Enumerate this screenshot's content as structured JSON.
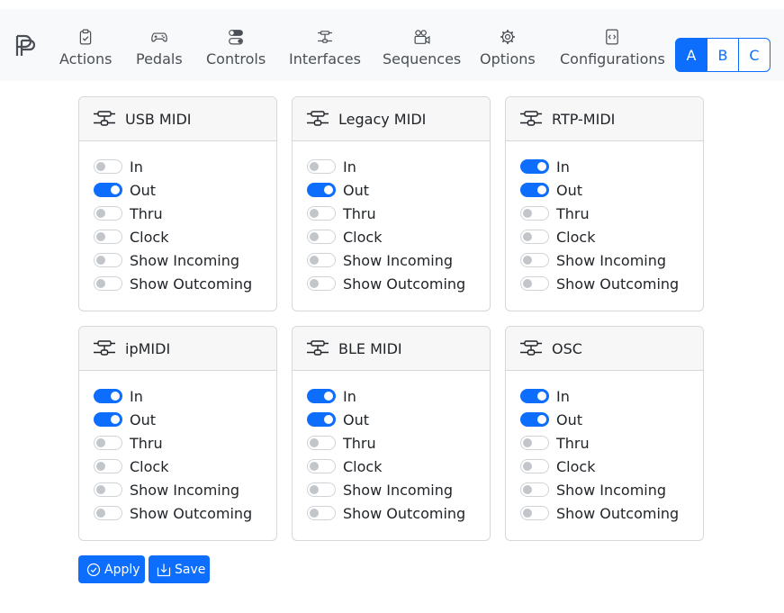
{
  "nav": {
    "items": [
      {
        "label": "Actions",
        "icon": "clipboard-check-icon"
      },
      {
        "label": "Pedals",
        "icon": "controller-icon"
      },
      {
        "label": "Controls",
        "icon": "toggles-icon"
      },
      {
        "label": "Interfaces",
        "icon": "sliders-icon"
      },
      {
        "label": "Sequences",
        "icon": "camera-reels-icon"
      },
      {
        "label": "Options",
        "icon": "gear-icon"
      },
      {
        "label": "Configurations",
        "icon": "file-code-icon"
      }
    ],
    "profiles": [
      {
        "label": "A",
        "active": true
      },
      {
        "label": "B",
        "active": false
      },
      {
        "label": "C",
        "active": false
      }
    ]
  },
  "interfaces": [
    {
      "title": "USB MIDI",
      "options": [
        {
          "label": "In",
          "on": false
        },
        {
          "label": "Out",
          "on": true
        },
        {
          "label": "Thru",
          "on": false
        },
        {
          "label": "Clock",
          "on": false
        },
        {
          "label": "Show Incoming",
          "on": false
        },
        {
          "label": "Show Outcoming",
          "on": false
        }
      ]
    },
    {
      "title": "Legacy MIDI",
      "options": [
        {
          "label": "In",
          "on": false
        },
        {
          "label": "Out",
          "on": true
        },
        {
          "label": "Thru",
          "on": false
        },
        {
          "label": "Clock",
          "on": false
        },
        {
          "label": "Show Incoming",
          "on": false
        },
        {
          "label": "Show Outcoming",
          "on": false
        }
      ]
    },
    {
      "title": "RTP-MIDI",
      "options": [
        {
          "label": "In",
          "on": true
        },
        {
          "label": "Out",
          "on": true
        },
        {
          "label": "Thru",
          "on": false
        },
        {
          "label": "Clock",
          "on": false
        },
        {
          "label": "Show Incoming",
          "on": false
        },
        {
          "label": "Show Outcoming",
          "on": false
        }
      ]
    },
    {
      "title": "ipMIDI",
      "options": [
        {
          "label": "In",
          "on": true
        },
        {
          "label": "Out",
          "on": true
        },
        {
          "label": "Thru",
          "on": false
        },
        {
          "label": "Clock",
          "on": false
        },
        {
          "label": "Show Incoming",
          "on": false
        },
        {
          "label": "Show Outcoming",
          "on": false
        }
      ]
    },
    {
      "title": "BLE MIDI",
      "options": [
        {
          "label": "In",
          "on": true
        },
        {
          "label": "Out",
          "on": true
        },
        {
          "label": "Thru",
          "on": false
        },
        {
          "label": "Clock",
          "on": false
        },
        {
          "label": "Show Incoming",
          "on": false
        },
        {
          "label": "Show Outcoming",
          "on": false
        }
      ]
    },
    {
      "title": "OSC",
      "options": [
        {
          "label": "In",
          "on": true
        },
        {
          "label": "Out",
          "on": true
        },
        {
          "label": "Thru",
          "on": false
        },
        {
          "label": "Clock",
          "on": false
        },
        {
          "label": "Show Incoming",
          "on": false
        },
        {
          "label": "Show Outcoming",
          "on": false
        }
      ]
    }
  ],
  "actions": {
    "apply_label": "Apply",
    "save_label": "Save"
  },
  "colors": {
    "accent": "#0d6efd",
    "navbar_bg": "#f8f9fa",
    "card_header_bg": "#f7f7f7"
  }
}
